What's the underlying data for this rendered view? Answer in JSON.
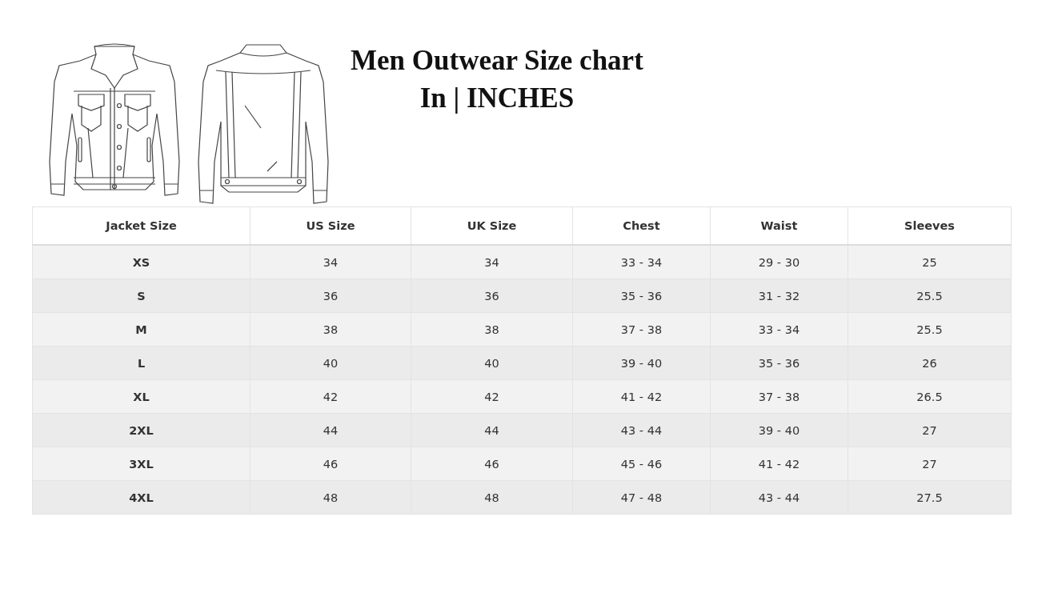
{
  "title": {
    "line_1": "Men Outwear Size chart",
    "line_2": "In | INCHES"
  },
  "table": {
    "columns": [
      "Jacket Size",
      "US Size",
      "UK Size",
      "Chest",
      "Waist",
      "Sleeves"
    ],
    "rows": [
      [
        "XS",
        "34",
        "34",
        "33 - 34",
        "29 - 30",
        "25"
      ],
      [
        "S",
        "36",
        "36",
        "35 - 36",
        "31 - 32",
        "25.5"
      ],
      [
        "M",
        "38",
        "38",
        "37 - 38",
        "33 - 34",
        "25.5"
      ],
      [
        "L",
        "40",
        "40",
        "39 - 40",
        "35 - 36",
        "26"
      ],
      [
        "XL",
        "42",
        "42",
        "41 - 42",
        "37 - 38",
        "26.5"
      ],
      [
        "2XL",
        "44",
        "44",
        "43 - 44",
        "39 - 40",
        "27"
      ],
      [
        "3XL",
        "46",
        "46",
        "45 - 46",
        "41 - 42",
        "27"
      ],
      [
        "4XL",
        "48",
        "48",
        "47 - 48",
        "43 - 44",
        "27.5"
      ]
    ]
  }
}
